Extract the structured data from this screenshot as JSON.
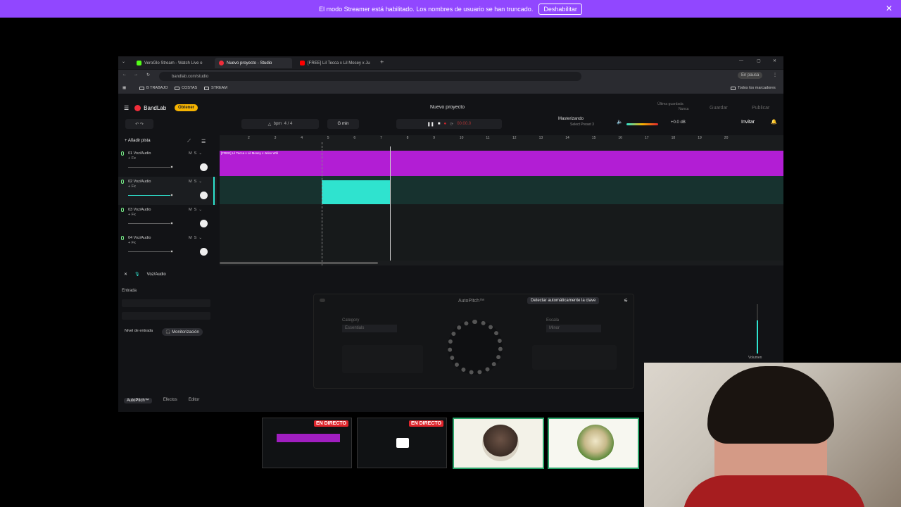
{
  "banner": {
    "text": "El modo Streamer está habilitado. Los nombres de usuario se han truncado.",
    "button": "Deshabilitar"
  },
  "browser": {
    "tabs": [
      "VeroGlo Stream - Watch Live o",
      "Nuevo proyecto - Studio",
      "[FREE] Lil Tecca x Lil Mosey x Ju"
    ],
    "url": "bandlab.com/studio",
    "bookmarks": [
      "B TRABAJO",
      "COSTAS",
      "STREAM"
    ],
    "all_bookmarks": "Todos los marcadores",
    "profile": "En pausa"
  },
  "bandlab": {
    "logo": "BandLab",
    "obtener": "Obtener",
    "project_title": "Nuevo proyecto",
    "last_saved": "Última guardada",
    "last_saved_value": "Nunca",
    "guardar": "Guardar",
    "publicar": "Publicar",
    "invitar": "Invitar",
    "key": "G min",
    "bpm": "bpm",
    "time_sig": "4 / 4",
    "time": "00:00.0",
    "mastering": "Masterizando",
    "preset": "Select Preset 3",
    "db": "+0.0 dB",
    "add_track": "Añadir pista"
  },
  "tracks": [
    {
      "name": "01 Voz/Audio",
      "fx": "+ Fx"
    },
    {
      "name": "02 Voz/Audio",
      "fx": "+ Fx"
    },
    {
      "name": "03 Voz/Audio",
      "fx": "+ Fx"
    },
    {
      "name": "04 Voz/Audio",
      "fx": "+ Fx"
    }
  ],
  "ruler": [
    "2",
    "3",
    "4",
    "5",
    "6",
    "7",
    "8",
    "9",
    "10",
    "11",
    "12",
    "13",
    "14",
    "15",
    "16",
    "17",
    "18",
    "19",
    "20"
  ],
  "clip_title": "[FREE] Lil Tecca x Lil Mosey x Jelox Wifi",
  "editor": {
    "track": "Voz/Audio",
    "entrada": "Entrada",
    "nivel": "Nivel de entrada",
    "monitorizacion": "Monitorización",
    "autopitch_title": "AutoPitch™",
    "detect": "Detectar automáticamente la clave",
    "category_label": "Category",
    "category_value": "Essentials",
    "escala_label": "Escala",
    "escala_value": "Minor",
    "volume": "Volumen",
    "tabs": [
      "AutoPitch™",
      "Efectos",
      "Editor"
    ]
  },
  "overlay": {
    "live_label": "EN DIRECTO"
  }
}
